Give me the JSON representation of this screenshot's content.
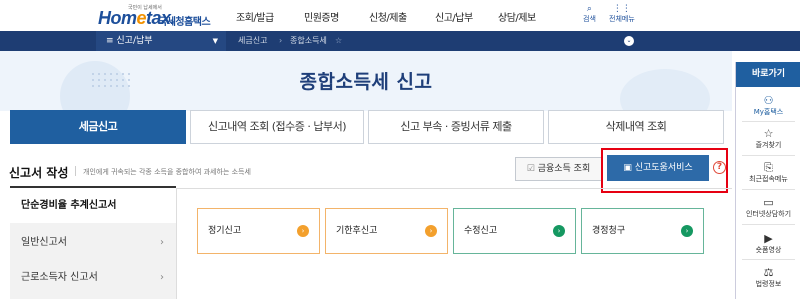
{
  "header": {
    "logo_tagline": "국민이 납세에서",
    "logo_text_a": "Hom",
    "logo_text_e": "e",
    "logo_text_b": "tax.",
    "logo_korean": "국세청홈택스",
    "gnb": [
      "조회/발급",
      "민원증명",
      "신청/제출",
      "신고/납부",
      "상담/제보"
    ],
    "search_label": "검색",
    "allmenu_label": "전체메뉴"
  },
  "navbar": {
    "menu_label": "≡  신고/납부",
    "crumbs": [
      "세금신고",
      "종합소득세"
    ]
  },
  "page_title": "종합소득세 신고",
  "tabs": [
    "세금신고",
    "신고내역 조회 (접수증 · 납부서)",
    "신고 부속 · 증빙서류 제출",
    "삭제내역 조회"
  ],
  "section": {
    "title": "신고서 작성",
    "description": "개인에게 귀속되는 각종 소득을 종합하여 과세하는 소득세",
    "btn_financial": "금융소득 조회",
    "btn_help": "신고도움서비스",
    "help_q": "?"
  },
  "left_menu": [
    {
      "label": "단순경비율 추계신고서",
      "active": true
    },
    {
      "label": "일반신고서",
      "active": false
    },
    {
      "label": "근로소득자 신고서",
      "active": false
    }
  ],
  "cards": [
    {
      "label": "정기신고",
      "color": "orange"
    },
    {
      "label": "기한후신고",
      "color": "orange"
    },
    {
      "label": "수정신고",
      "color": "green"
    },
    {
      "label": "경정청구",
      "color": "green"
    }
  ],
  "quick": {
    "head": "바로가기",
    "items": [
      "My홈택스",
      "즐겨찾기",
      "최근접속메뉴",
      "인터넷상담하기",
      "숏폼영상",
      "법령정보"
    ]
  },
  "colors": {
    "navy": "#1e3d73",
    "accent_blue": "#1f5fa0",
    "highlight_red": "#e60012",
    "orange": "#f3a02d",
    "green": "#159861"
  }
}
